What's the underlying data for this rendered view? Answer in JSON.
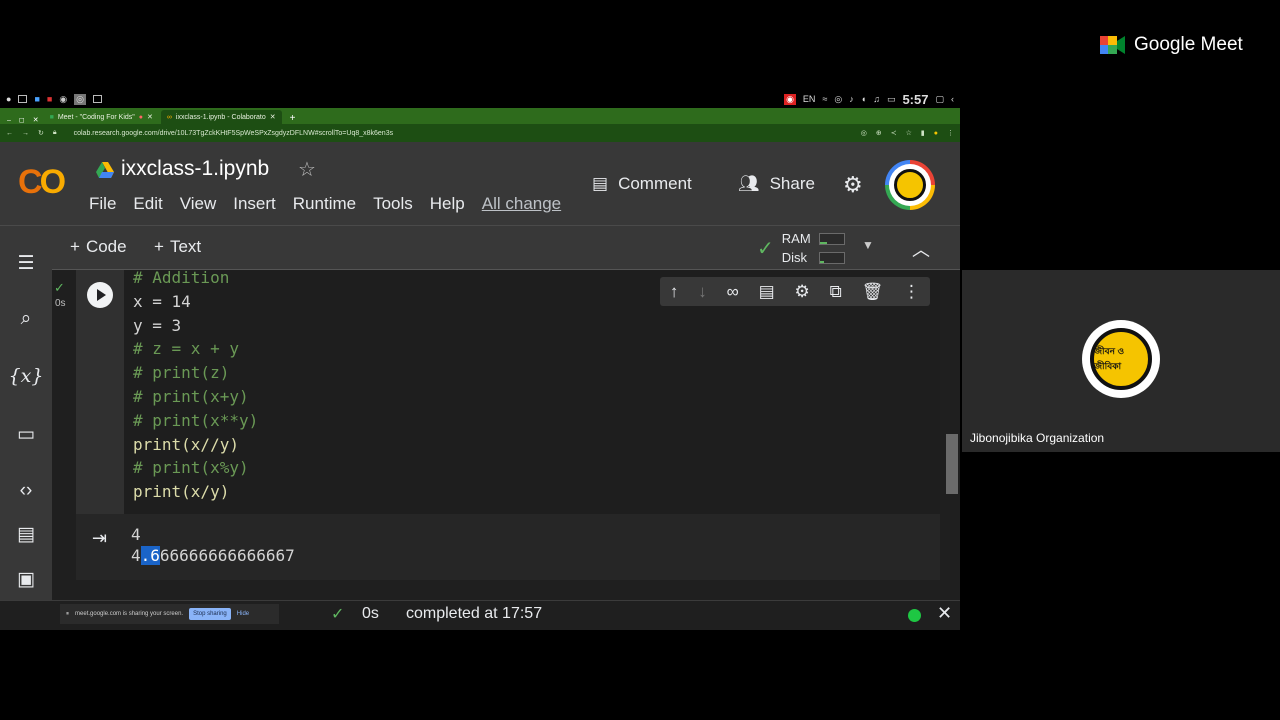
{
  "meet": {
    "brand": "Google Meet",
    "participant_name": "Jibonojibika Organization",
    "avatar_text": "জীবন ও জীবিকা"
  },
  "os_tray": {
    "lang": "EN",
    "clock": "5:57"
  },
  "browser": {
    "tabs": [
      {
        "label": "Meet - \"Coding For Kids\"",
        "active": false
      },
      {
        "label": "ixxclass-1.ipynb - Colaborato",
        "active": true
      }
    ],
    "new_tab": "+",
    "url": "colab.research.google.com/drive/10L73TgZckKHtF5SpWeSPxZsgdyzDFLNW#scrollTo=Uq8_x8k6en3s"
  },
  "colab": {
    "logo": "CO",
    "notebook_title": "ixxclass-1.ipynb",
    "menu": [
      "File",
      "Edit",
      "View",
      "Insert",
      "Runtime",
      "Tools",
      "Help"
    ],
    "save_status": "All change",
    "comment_label": "Comment",
    "share_label": "Share",
    "toolbar": {
      "add_code": "Code",
      "add_text": "Text"
    },
    "resources": {
      "ram_label": "RAM",
      "disk_label": "Disk"
    },
    "cell": {
      "exec_time": "0s",
      "lines": [
        "# Addition",
        "x = 14",
        "y = 3",
        "# z = x + y",
        "# print(z)",
        "# print(x+y)",
        "# print(x**y)",
        "print(x//y)",
        "# print(x%y)",
        "print(x/y)"
      ]
    },
    "output": {
      "line1": "4",
      "line2_pre": "4",
      "line2_sel": ".6",
      "line2_post": "66666666666667"
    },
    "status": {
      "time": "0s",
      "completed": "completed at 17:57"
    }
  },
  "screen_share_bar": {
    "message": "meet.google.com is sharing your screen.",
    "stop": "Stop sharing",
    "hide": "Hide"
  },
  "colors": {
    "colab_orange": "#f9ab00",
    "tab_green": "#2e6b1c",
    "ok_green": "#1ec743",
    "selection_blue": "#1a64c8"
  }
}
